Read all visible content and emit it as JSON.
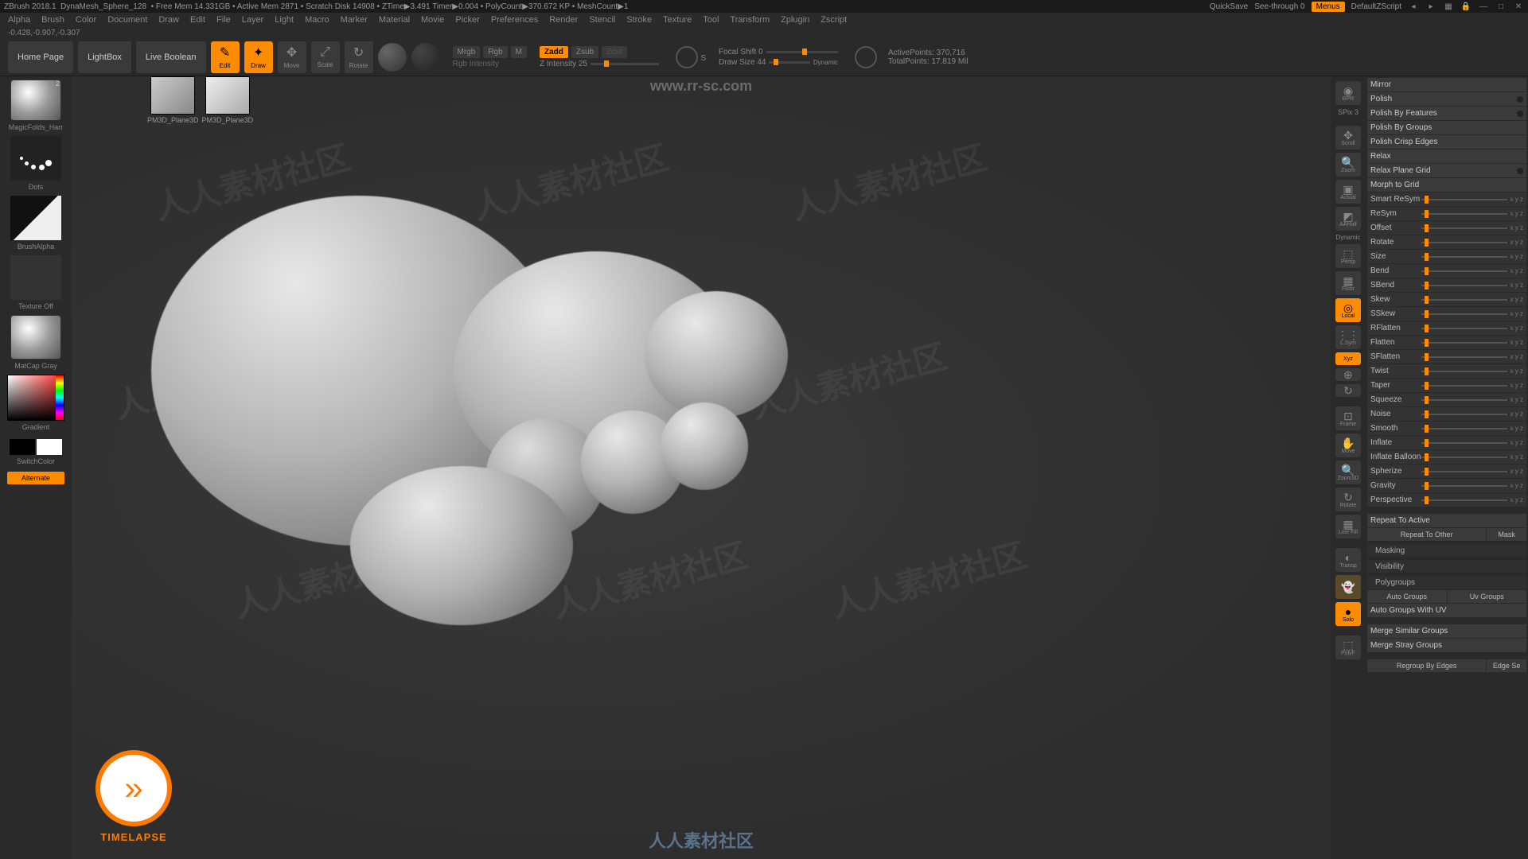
{
  "titleBar": {
    "app": "ZBrush 2018.1",
    "project": "DynaMesh_Sphere_128",
    "stats": "• Free Mem 14.331GB • Active Mem 2871 • Scratch Disk 14908 • ZTime▶3.491 Timer▶0.004 • PolyCount▶370.672 KP • MeshCount▶1",
    "quickSave": "QuickSave",
    "seeThrough": "See-through  0",
    "menus": "Menus",
    "defaultScript": "DefaultZScript"
  },
  "menuBar": [
    "Alpha",
    "Brush",
    "Color",
    "Document",
    "Draw",
    "Edit",
    "File",
    "Layer",
    "Light",
    "Macro",
    "Marker",
    "Material",
    "Movie",
    "Picker",
    "Preferences",
    "Render",
    "Stencil",
    "Stroke",
    "Texture",
    "Tool",
    "Transform",
    "Zplugin",
    "Zscript"
  ],
  "coords": "-0.428,-0.907,-0.307",
  "toolbar": {
    "homePage": "Home Page",
    "lightBox": "LightBox",
    "liveBoolean": "Live Boolean",
    "edit": "Edit",
    "draw": "Draw",
    "move": "Move",
    "scale": "Scale",
    "rotate": "Rotate",
    "mrgb": "Mrgb",
    "rgb": "Rgb",
    "m": "M",
    "rgbIntensity": "Rgb Intensity",
    "zadd": "Zadd",
    "zsub": "Zsub",
    "zcut": "Zcut",
    "zIntensity": "Z Intensity 25",
    "focalShift": "Focal Shift 0",
    "drawSize": "Draw Size 44",
    "dynamic": "Dynamic",
    "activePoints": "ActivePoints: 370,716",
    "totalPoints": "TotalPoints: 17.819 Mil",
    "s": "S"
  },
  "thumbStrip": [
    {
      "label": "PM3D_Plane3D"
    },
    {
      "label": "PM3D_Plane3D"
    }
  ],
  "leftPanel": {
    "brush": "MagicFolds_Harr",
    "stroke": "Dots",
    "alpha": "BrushAlpha",
    "texture": "Texture Off",
    "material": "MatCap Gray",
    "gradient": "Gradient",
    "switchColor": "SwitchColor",
    "alternate": "Alternate",
    "thumbBadge": "2"
  },
  "rightIcons": {
    "bpr": "BPR",
    "spix": "SPix 3",
    "scroll": "Scroll",
    "zoom": "Zoom",
    "actual": "Actual",
    "aahalf": "AAHalf",
    "persp": "Persp",
    "dynamic": "Dynamic",
    "floor": "Floor",
    "local": "Local",
    "lsym": "L.Sym",
    "xyz": "Xyz",
    "frame": "Frame",
    "move": "Move",
    "zoom3d": "Zoom3D",
    "rotate": "Rotate",
    "linefill": "Line Fill",
    "transp": "Transp",
    "ghost": "Ghost",
    "solo": "Solo",
    "polyf": "PolyF"
  },
  "rightPanel": {
    "topButtons": [
      "Mirror",
      "Polish",
      "Polish By Features",
      "Polish By Groups",
      "Polish Crisp Edges",
      "Relax",
      "Relax Plane Grid",
      "Morph to Grid"
    ],
    "sliders": [
      "Smart ReSym",
      "ReSym",
      "Offset",
      "Rotate",
      "Size",
      "Bend",
      "SBend",
      "Skew",
      "SSkew",
      "RFlatten",
      "Flatten",
      "SFlatten",
      "Twist",
      "Taper",
      "Squeeze",
      "Noise",
      "Smooth",
      "Inflate",
      "Inflate Balloon",
      "Spherize",
      "Gravity",
      "Perspective"
    ],
    "repeat1": "Repeat To Active",
    "repeat2": "Repeat To Other",
    "mask": "Mask",
    "sections": [
      "Masking",
      "Visibility",
      "Polygroups"
    ],
    "polyBtns1": [
      "Auto Groups",
      "Uv Groups"
    ],
    "polyBtns2": "Auto Groups With UV",
    "polyBtns3": "Merge Similar Groups",
    "polyBtns4": "Merge Stray Groups",
    "polyBtns5": [
      "Regroup By Edges",
      "Edge Se"
    ]
  },
  "timelapse": "TIMELAPSE",
  "centerWatermark": "www.rr-sc.com",
  "bottomWatermark": "人人素材社区"
}
